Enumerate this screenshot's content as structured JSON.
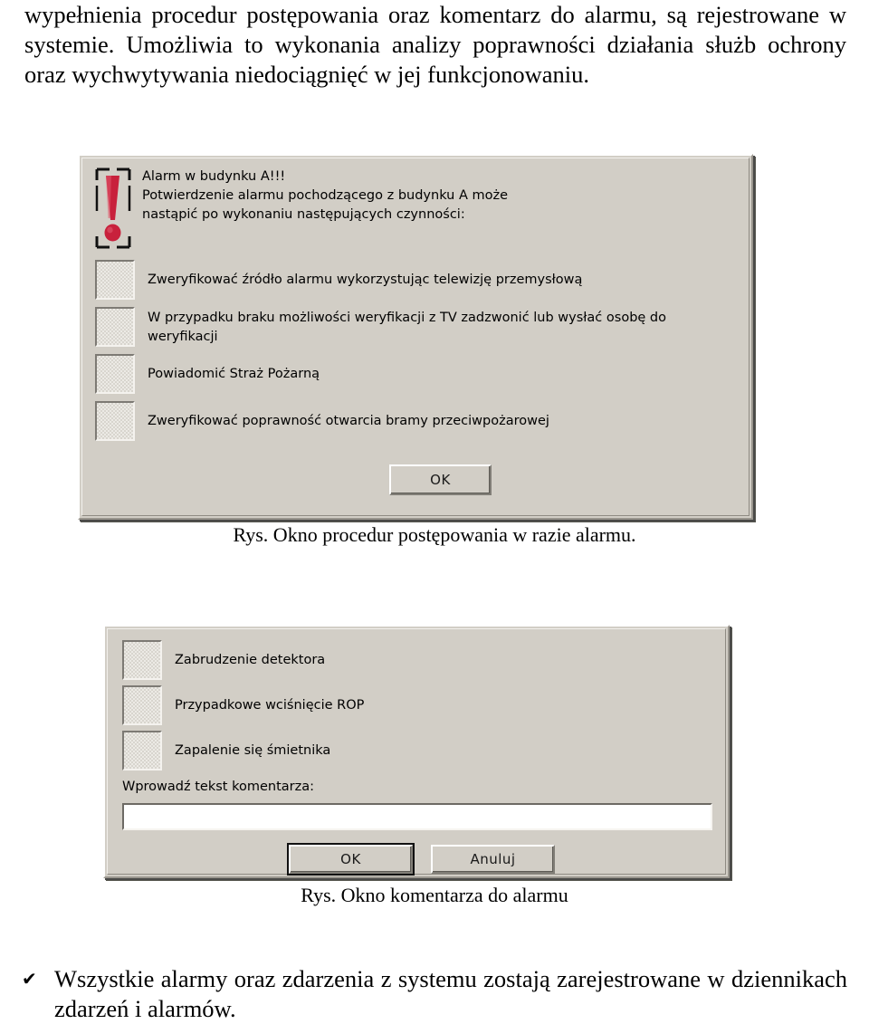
{
  "document": {
    "paragraph_top": "wypełnienia procedur postępowania oraz komentarz do alarmu, są rejestrowane w systemie. Umożliwia to wykonania analizy poprawności działania służb ochrony oraz wychwytywania niedociągnięć w jej funkcjonowaniu.",
    "bullet": {
      "marker": "✔",
      "text": "Wszystkie alarmy oraz zdarzenia z systemu zostają zarejestrowane w dziennikach zdarzeń i alarmów."
    }
  },
  "figure1": {
    "caption": "Rys. Okno procedur postępowania w razie alarmu.",
    "dialog": {
      "icon": "alarm-exclamation-icon",
      "message": "Alarm w budynku A!!!\nPotwierdzenie alarmu pochodzącego z budynku A może\nnastąpić po wykonaniu następujących czynności:",
      "checkitems": [
        {
          "label": "Zweryfikować źródło alarmu wykorzystując telewizję przemysłową",
          "checked": false
        },
        {
          "label": "W przypadku braku możliwości weryfikacji z TV zadzwonić lub wysłać osobę do weryfikacji",
          "checked": false
        },
        {
          "label": "Powiadomić Straż Pożarną",
          "checked": false
        },
        {
          "label": "Zweryfikować poprawność otwarcia bramy przeciwpożarowej",
          "checked": false
        }
      ],
      "ok_label": "OK"
    }
  },
  "figure2": {
    "caption": "Rys. Okno komentarza do alarmu",
    "dialog": {
      "checkitems": [
        {
          "label": "Zabrudzenie detektora",
          "checked": false
        },
        {
          "label": "Przypadkowe wciśnięcie ROP",
          "checked": false
        },
        {
          "label": "Zapalenie się śmietnika",
          "checked": false
        }
      ],
      "comment_label": "Wprowadź tekst komentarza:",
      "comment_value": "",
      "comment_placeholder": "",
      "ok_label": "OK",
      "cancel_label": "Anuluj"
    }
  },
  "colors": {
    "dialog_face": "#d2cec6",
    "alarm_red": "#c8213c",
    "text": "#000000",
    "page_background": "#ffffff"
  }
}
